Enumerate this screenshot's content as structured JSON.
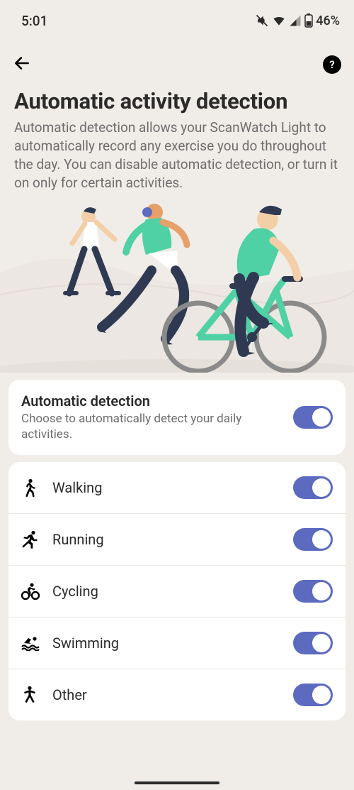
{
  "status": {
    "time": "5:01",
    "battery_text": "46%"
  },
  "header": {
    "title": "Automatic activity detection",
    "description": "Automatic detection allows your ScanWatch Light to automatically record any exercise you do throughout the day. You can disable automatic detection, or turn it on only for certain activities."
  },
  "master_toggle": {
    "title": "Automatic detection",
    "subtitle": "Choose to automatically detect your daily activities.",
    "on": true
  },
  "activities": [
    {
      "icon": "walking-icon",
      "label": "Walking",
      "on": true
    },
    {
      "icon": "running-icon",
      "label": "Running",
      "on": true
    },
    {
      "icon": "cycling-icon",
      "label": "Cycling",
      "on": true
    },
    {
      "icon": "swimming-icon",
      "label": "Swimming",
      "on": true
    },
    {
      "icon": "other-icon",
      "label": "Other",
      "on": true
    }
  ],
  "help_label": "?",
  "colors": {
    "accent": "#5c6bc0",
    "bg": "#f0ece8",
    "text": "#2b2b2b",
    "muted": "#6e6e6e",
    "illus_green": "#4fd1a5",
    "illus_navy": "#2f3a52"
  }
}
